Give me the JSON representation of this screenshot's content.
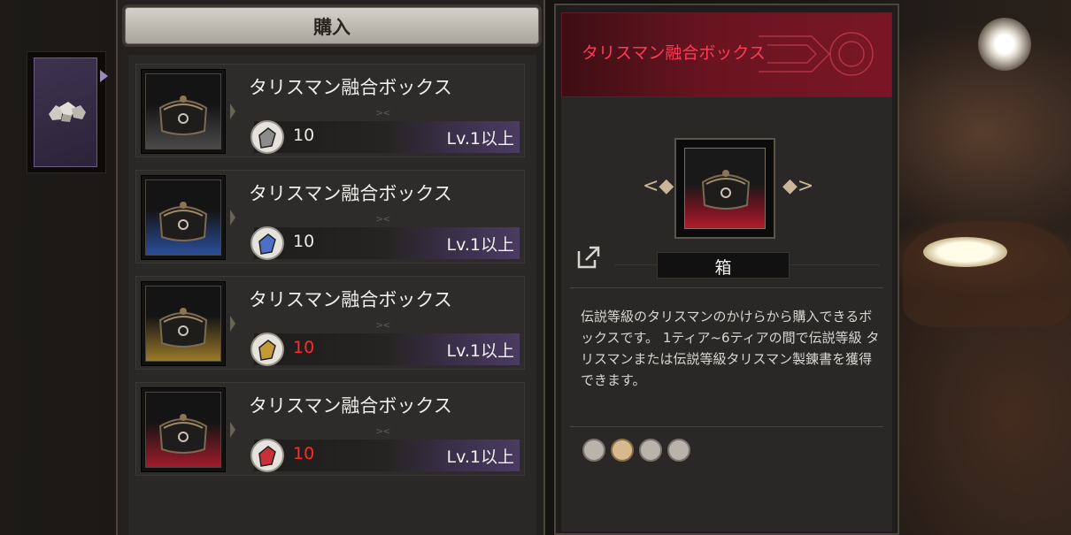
{
  "purchase_panel": {
    "title": "購入"
  },
  "left_tab": {
    "icon": "ore-icon"
  },
  "items": [
    {
      "name": "タリスマン融合ボックス",
      "price": "10",
      "price_warning": false,
      "level_req": "Lv.1以上",
      "rarity_color": "#4a4a4a",
      "currency_color": "#8c8c8c"
    },
    {
      "name": "タリスマン融合ボックス",
      "price": "10",
      "price_warning": false,
      "level_req": "Lv.1以上",
      "rarity_color": "#2a4e9a",
      "currency_color": "#4e6fc8"
    },
    {
      "name": "タリスマン融合ボックス",
      "price": "10",
      "price_warning": true,
      "level_req": "Lv.1以上",
      "rarity_color": "#9a7a2a",
      "currency_color": "#c29a3a"
    },
    {
      "name": "タリスマン融合ボックス",
      "price": "10",
      "price_warning": true,
      "level_req": "Lv.1以上",
      "rarity_color": "#a01c2c",
      "currency_color": "#c8303a"
    }
  ],
  "detail": {
    "title": "タリスマン融合ボックス",
    "type": "箱",
    "description": "伝説等級のタリスマンのかけらから購入できるボックスです。 1ティア~6ティアの間で伝説等級 タリスマンまたは伝説等級タリスマン製錬書を獲得できます。",
    "tags": [
      "crossed-circle-icon",
      "chest-icon",
      "no-trade-icon",
      "tools-icon"
    ]
  },
  "colors": {
    "price_warning": "#ff2b2b",
    "detail_title": "#ff3a55",
    "accent_purple": "#4a3b61"
  }
}
